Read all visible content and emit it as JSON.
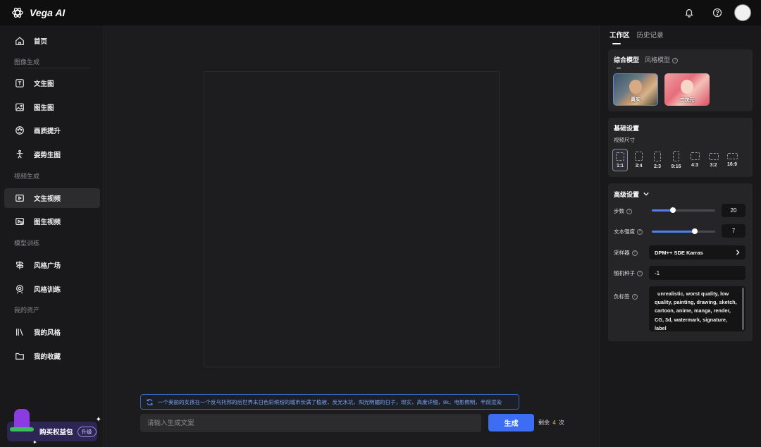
{
  "app": {
    "name": "Vega AI"
  },
  "sidebar": {
    "home": "首页",
    "sections": {
      "image": "图像生成",
      "video": "视频生成",
      "model": "模型训练",
      "assets": "我的资产"
    },
    "items": {
      "text_to_image": "文生图",
      "image_to_image": "图生图",
      "upscale": "画质提升",
      "pose": "姿势生图",
      "text_to_video": "文生视频",
      "image_to_video": "图生视频",
      "style_square": "风格广场",
      "style_training": "风格训练",
      "my_styles": "我的风格",
      "my_favorites": "我的收藏"
    },
    "promo": {
      "label": "购买权益包",
      "badge": "升级"
    }
  },
  "main": {
    "suggestion": "一个美丽的女孩在一个反乌托邦的后世界末日色彩缤纷的城市长满了植被，反光水坑，阳光明媚的日子，现实，高度详细，8k，电影照明，辛烷渲染",
    "input_placeholder": "请输入生成文案",
    "generate": "生成",
    "remaining_prefix": "剩余",
    "remaining_count": "4",
    "remaining_suffix": "次"
  },
  "right": {
    "tabs": [
      "工作区",
      "历史记录"
    ],
    "model_tabs": [
      "综合模型",
      "风格模型"
    ],
    "styles": [
      "真实",
      "二次元"
    ],
    "basic": {
      "title": "基础设置",
      "size_label": "视频尺寸",
      "ratios": [
        "1:1",
        "3:4",
        "2:3",
        "9:16",
        "4:3",
        "3:2",
        "16:9"
      ],
      "selected_ratio": "1:1"
    },
    "advanced": {
      "title": "高级设置",
      "steps_label": "步数",
      "steps_value": "20",
      "steps_fraction": 0.33,
      "text_strength_label": "文本强度",
      "text_strength_value": "7",
      "text_strength_fraction": 0.68,
      "sampler_label": "采样器",
      "sampler_value": "DPM++ SDE Karras",
      "seed_label": "随机种子",
      "seed_value": "-1",
      "negative_label": "负标签",
      "negative_value": "unrealistic, worst quality, low quality, painting, drawing, sketch, cartoon, anime, manga, render, CG, 3d, watermark, signature, label"
    }
  },
  "colors": {
    "accent": "#3d6df2",
    "highlight": "#f0c24a"
  }
}
